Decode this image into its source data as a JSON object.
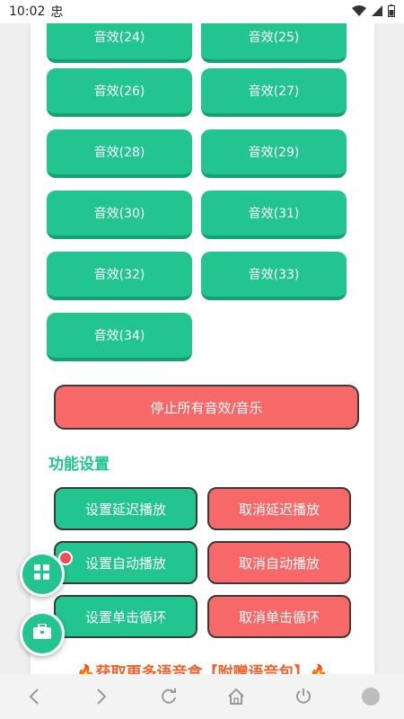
{
  "status_bar": {
    "time": "10:02",
    "carrier_glyph": "忠",
    "battery_icon": "battery-icon"
  },
  "effects": [
    {
      "label": "音效(24)"
    },
    {
      "label": "音效(25)"
    },
    {
      "label": "音效(26)"
    },
    {
      "label": "音效(27)"
    },
    {
      "label": "音效(28)"
    },
    {
      "label": "音效(29)"
    },
    {
      "label": "音效(30)"
    },
    {
      "label": "音效(31)"
    },
    {
      "label": "音效(32)"
    },
    {
      "label": "音效(33)"
    },
    {
      "label": "音效(34)"
    }
  ],
  "stop_all": {
    "label": "停止所有音效/音乐"
  },
  "settings": {
    "title": "功能设置",
    "rows": [
      {
        "set": "设置延迟播放",
        "cancel": "取消延迟播放"
      },
      {
        "set": "设置自动播放",
        "cancel": "取消自动播放"
      },
      {
        "set": "设置单击循环",
        "cancel": "取消单击循环"
      }
    ]
  },
  "promo": {
    "text": "🔥获取更多语音盒【附赠语音包】🔥"
  },
  "colors": {
    "green": "#22c48f",
    "red": "#f76868",
    "orange": "#f1632d",
    "badge": "#f04a5b"
  },
  "fabs": [
    {
      "icon": "grid-icon",
      "has_badge": true
    },
    {
      "icon": "toolbox-icon",
      "has_badge": false
    }
  ],
  "nav": [
    {
      "icon": "back-icon"
    },
    {
      "icon": "forward-icon"
    },
    {
      "icon": "refresh-icon"
    },
    {
      "icon": "home-icon"
    },
    {
      "icon": "power-icon"
    },
    {
      "icon": "circle-icon"
    }
  ]
}
